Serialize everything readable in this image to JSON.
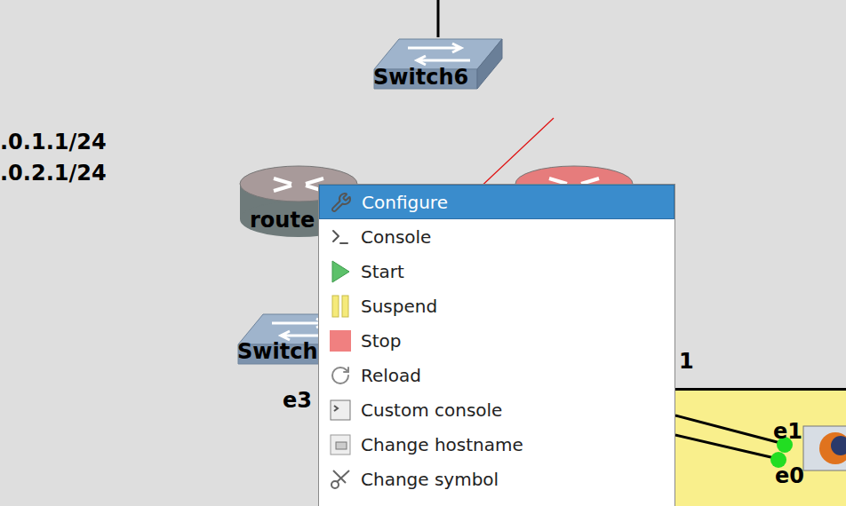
{
  "canvas": {
    "address_labels": [
      ".0.1.1/24",
      ".0.2.1/24"
    ],
    "nodes": [
      {
        "label": "Switch6",
        "kind": "switch"
      },
      {
        "label": "route",
        "kind": "router"
      },
      {
        "label": "",
        "kind": "router-red"
      },
      {
        "label": "Switch",
        "kind": "switch"
      }
    ],
    "interface_labels": [
      "e3",
      "e1",
      "e0"
    ],
    "stray_labels": [
      "1"
    ],
    "link_status": [
      {
        "interface": "e1",
        "up": true,
        "color": "#22dd22"
      },
      {
        "interface": "e0",
        "up": true,
        "color": "#22dd22"
      }
    ]
  },
  "context_menu": {
    "items": [
      {
        "label": "Configure",
        "selected": true
      },
      {
        "label": "Console",
        "selected": false
      },
      {
        "label": "Start",
        "selected": false
      },
      {
        "label": "Suspend",
        "selected": false
      },
      {
        "label": "Stop",
        "selected": false
      },
      {
        "label": "Reload",
        "selected": false
      },
      {
        "label": "Custom console",
        "selected": false
      },
      {
        "label": "Change hostname",
        "selected": false
      },
      {
        "label": "Change symbol",
        "selected": false
      }
    ]
  }
}
